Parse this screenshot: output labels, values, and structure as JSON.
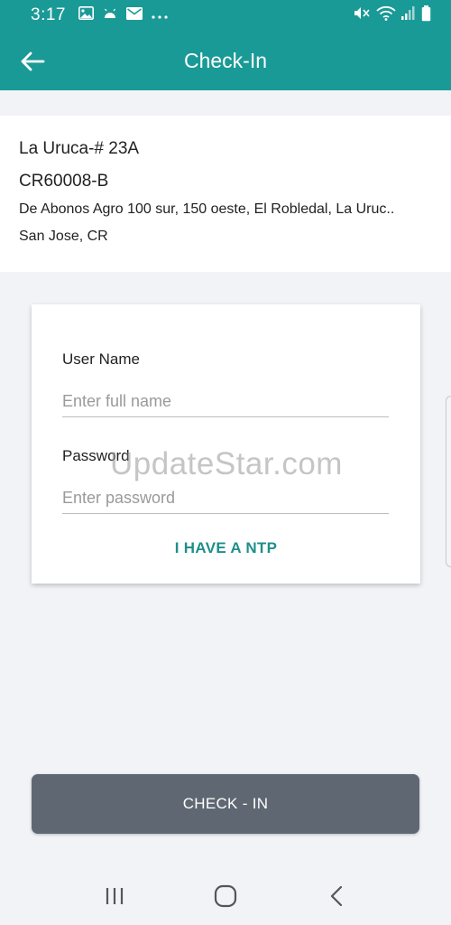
{
  "status_bar": {
    "time": "3:17",
    "left_icons": [
      "image-icon",
      "android-icon",
      "mail-icon",
      "more-icon"
    ],
    "right_icons": [
      "mute-icon",
      "wifi-icon",
      "signal-icon",
      "battery-icon"
    ]
  },
  "app_bar": {
    "title": "Check-In",
    "back_icon": "arrow-left-icon"
  },
  "site": {
    "name": "La Uruca-# 23A",
    "code": "CR60008-B",
    "address": "De Abonos Agro 100 sur, 150 oeste, El Robledal, La Uruc..",
    "city": "San Jose, CR"
  },
  "login": {
    "username_label": "User Name",
    "username_placeholder": "Enter full name",
    "username_value": "",
    "password_label": "Password",
    "password_placeholder": "Enter password",
    "password_value": "",
    "ntp_link": "I HAVE A NTP"
  },
  "watermark": "UpdateStar.com",
  "checkin_button": "CHECK - IN",
  "nav_bar": {
    "icons": [
      "recent-apps-icon",
      "home-icon",
      "back-icon"
    ]
  },
  "colors": {
    "primary": "#1a9a96",
    "accent_text": "#1f8f8b",
    "button": "#5f6872",
    "background": "#f2f3f7"
  }
}
